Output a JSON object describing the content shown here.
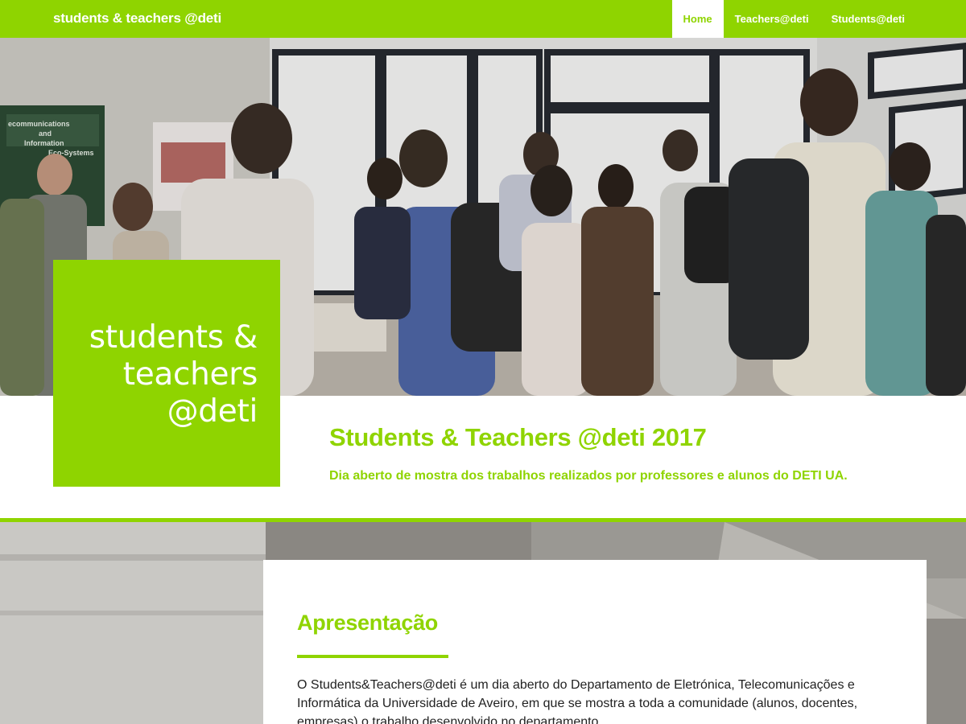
{
  "navbar": {
    "brand": "students & teachers @deti",
    "items": [
      {
        "label": "Home",
        "active": true
      },
      {
        "label": "Teachers@deti",
        "active": false
      },
      {
        "label": "Students@deti",
        "active": false
      }
    ]
  },
  "hero": {
    "image": "photo of students and teachers gathered in a room at an open day event",
    "badge_lines": [
      "students &",
      "teachers",
      "@deti"
    ],
    "poster_text": [
      "ecommunications",
      "and",
      "Information",
      "Eco-Systems"
    ]
  },
  "event": {
    "title": "Students & Teachers @deti 2017",
    "subtitle": "Dia aberto de mostra dos trabalhos realizados por professores e alunos do DETI UA."
  },
  "presentation": {
    "title": "Apresentação",
    "text": "O Students&Teachers@deti é um dia aberto do Departamento de Eletrónica, Telecomunicações e Informática da Universidade de Aveiro, em que se mostra a toda a comunidade (alunos, docentes, empresas) o trabalho desenvolvido no departamento."
  },
  "colors": {
    "accent": "#8fd400",
    "text": "#222222"
  }
}
